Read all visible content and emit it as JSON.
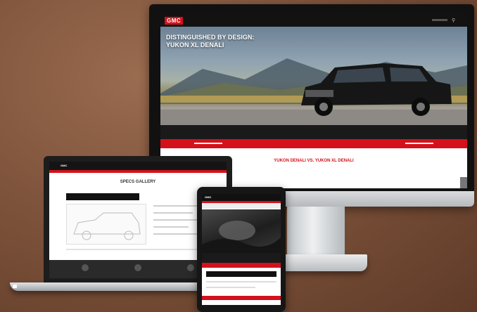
{
  "monitor": {
    "logo": "GMC",
    "nav_items": [
      "",
      "",
      "",
      ""
    ],
    "hero_title": "DISTINGUISHED BY DESIGN: YUKON XL DENALI",
    "stats": [
      {
        "value": "",
        "label": ""
      },
      {
        "value": "",
        "label": ""
      },
      {
        "value": "",
        "label": ""
      }
    ],
    "section_title": "YUKON DENALI VS. YUKON XL DENALI"
  },
  "laptop": {
    "logo": "GMC",
    "section_title": "SPECS GALLERY"
  },
  "tablet": {
    "logo": "GMC"
  },
  "colors": {
    "brand_red": "#d4111b",
    "dark": "#111111",
    "background": "#7e533b"
  }
}
